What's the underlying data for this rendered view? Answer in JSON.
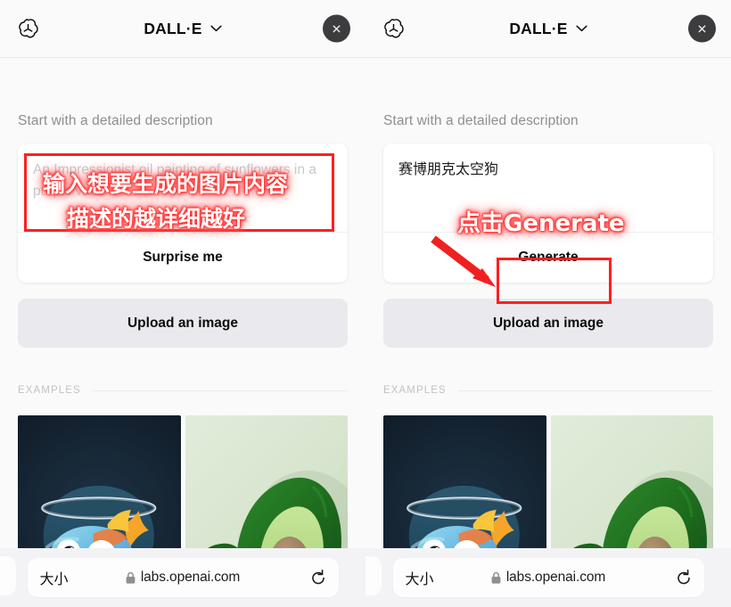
{
  "meta": {
    "accent_red": "#ff1f1f",
    "page_bg": "#fafafa",
    "upload_bg": "#eaeaee",
    "close_btn_bg": "#3c3c3e"
  },
  "header": {
    "logo_name": "openai-logo",
    "title": "DALL·E",
    "chevron": "chevron-down-icon",
    "close_label": "✕"
  },
  "main": {
    "section_label": "Start with a detailed description",
    "surprise_label": "Surprise me",
    "generate_label": "Generate",
    "upload_label": "Upload an image",
    "examples_label": "EXAMPLES"
  },
  "prompt_left": {
    "placeholder": "An Impressionist oil painting of sunflowers in a purple vase...",
    "value": ""
  },
  "prompt_right": {
    "placeholder": "An Impressionist oil painting of sunflowers in a purple vase...",
    "value": "赛博朋克太空狗"
  },
  "examples": [
    {
      "name": "fish-in-fishbowl-thumbnail",
      "alt": "3D render of a colorful cartoon fish inside a glass fishbowl on a dark navy background"
    },
    {
      "name": "avocado-armchair-thumbnail",
      "alt": "Green velvet armchair shaped like an avocado on a pale green background"
    }
  ],
  "browser": {
    "text_size_label": "大小",
    "lock_icon": "lock-icon",
    "url": "labs.openai.com",
    "reload_icon": "reload-icon"
  },
  "annotations": {
    "left_line1": "输入想要生成的图片内容",
    "left_line2": "描述的越详细越好",
    "right_line1": "点击Generate",
    "arrow_name": "red-pointer-arrow"
  }
}
